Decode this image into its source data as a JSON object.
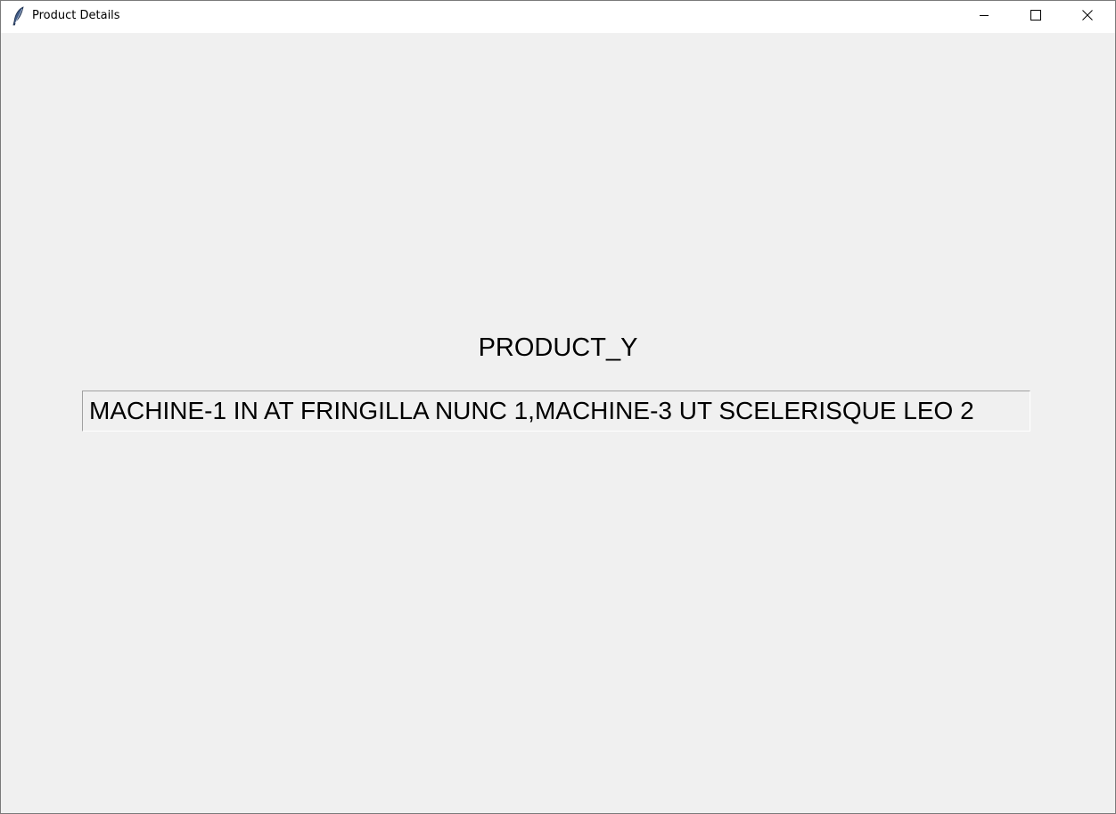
{
  "window": {
    "title": "Product Details",
    "app_icon": "feather-icon",
    "controls": {
      "minimize_icon": "minimize-icon",
      "maximize_icon": "maximize-icon",
      "close_icon": "close-icon"
    }
  },
  "main": {
    "product_name": "PRODUCT_Y",
    "details_value": "MACHINE-1 IN AT FRINGILLA NUNC 1,MACHINE-3 UT SCELERISQUE LEO 2"
  },
  "colors": {
    "background": "#f0f0f0",
    "titlebar": "#ffffff",
    "text": "#000000"
  }
}
